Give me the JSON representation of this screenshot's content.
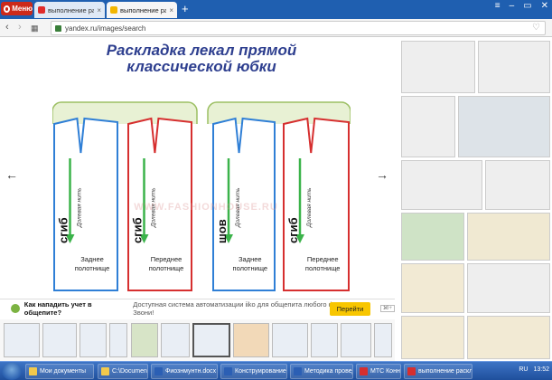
{
  "browser": {
    "menu_label": "Меню",
    "tabs": [
      {
        "label": "выполнение раскладо",
        "favicon_color": "#e02b2b"
      },
      {
        "label": "выполнение раскладок пр",
        "favicon_color": "#f2b600"
      }
    ],
    "new_tab_symbol": "+",
    "window_controls": [
      "≡",
      "–",
      "▭",
      "✕"
    ],
    "url": "yandex.ru/images/search"
  },
  "preview": {
    "title_line1": "Раскладка лекал прямой",
    "title_line2": "классической юбки",
    "watermark": "WWW.FASHIONHOUSE.RU",
    "pieces": [
      {
        "fold_label": "сгиб",
        "grain_label": "Долевая нить",
        "name_line1": "Заднее",
        "name_line2": "полотнище",
        "outline_color": "#2f7fd6"
      },
      {
        "fold_label": "сгиб",
        "grain_label": "Долевая нить",
        "name_line1": "Переднее",
        "name_line2": "полотнище",
        "outline_color": "#d62f2f"
      },
      {
        "fold_label": "шов",
        "grain_label": "Долевая нить",
        "name_line1": "Заднее",
        "name_line2": "полотнище",
        "outline_color": "#2f7fd6"
      },
      {
        "fold_label": "сгиб",
        "grain_label": "Долевая нить",
        "name_line1": "Переднее",
        "name_line2": "полотнище",
        "outline_color": "#d62f2f"
      }
    ],
    "fabric_color": "#e8f1d4",
    "fabric_border": "#9cbf63",
    "arrow_color": "#3bb34a"
  },
  "notification": {
    "question": "Как нападить учет в общепите?",
    "text": "Доступная система автоматизации iiko для общепита любого формата. Звони!",
    "ad_tag": "18+",
    "button": "Перейти",
    "close": "×"
  },
  "taskbar": {
    "items": [
      {
        "label": "Мои документы",
        "color": "#f2c94c"
      },
      {
        "label": "C:\\Documents and ...",
        "color": "#f2c94c"
      },
      {
        "label": "Фиознмунтн.docx - ...",
        "color": "#2b5fb4"
      },
      {
        "label": "Конструирование и ...",
        "color": "#2b5fb4"
      },
      {
        "label": "Методика проведе...",
        "color": "#2b5fb4"
      },
      {
        "label": "МТС Коннект",
        "color": "#d62f2f"
      },
      {
        "label": "выполнение расклад...",
        "color": "#d62f2f"
      }
    ],
    "lang": "RU",
    "time": "13:52"
  }
}
